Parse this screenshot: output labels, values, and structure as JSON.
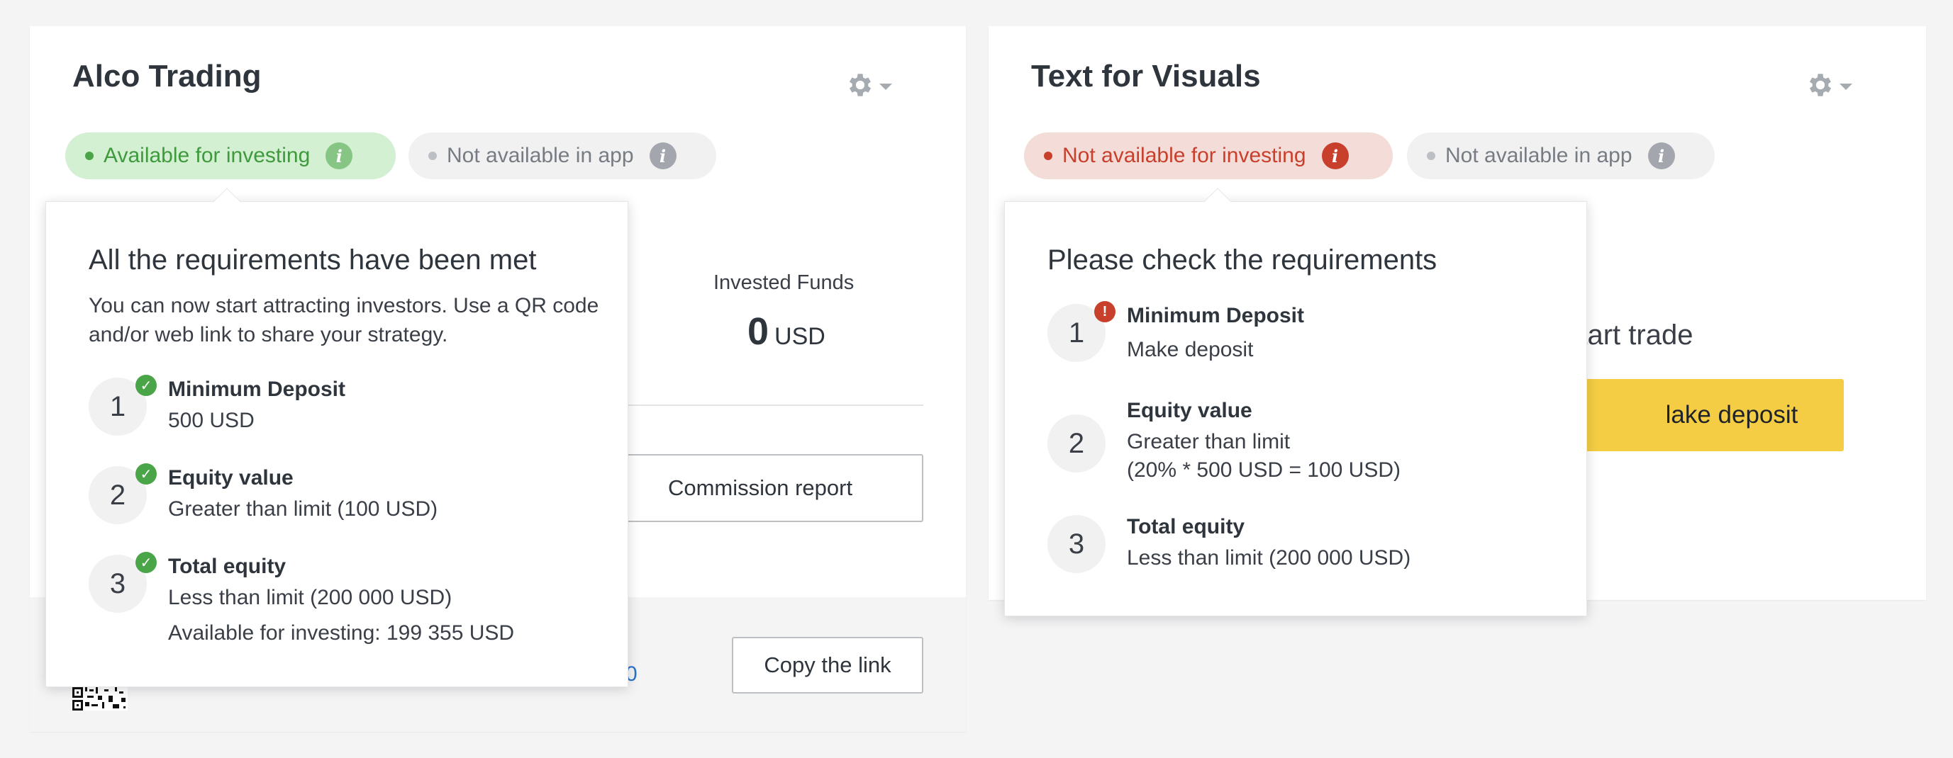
{
  "left_card": {
    "title": "Alco Trading",
    "pill_available": "Available for investing",
    "pill_app": "Not available in app",
    "invested_label": "Invested Funds",
    "invested_value": "0",
    "invested_unit": "USD",
    "commission_button": "Commission report",
    "link_fragment": "0",
    "copy_button": "Copy the link"
  },
  "left_popover": {
    "title": "All the requirements have been met",
    "description": "You can now start attracting investors. Use a QR code and/or web link to share your strategy.",
    "requirements": [
      {
        "num": "1",
        "title": "Minimum Deposit",
        "line1": "500 USD"
      },
      {
        "num": "2",
        "title": "Equity value",
        "line1": "Greater than limit (100 USD)"
      },
      {
        "num": "3",
        "title": "Total equity",
        "line1": "Less than limit (200 000 USD)",
        "line2": "Available for investing: 199 355 USD"
      }
    ]
  },
  "right_card": {
    "title": "Text for Visuals",
    "pill_available": "Not available for investing",
    "pill_app": "Not available in app",
    "start_trade_fragment": "o start trade",
    "deposit_button_fragment": "lake deposit"
  },
  "right_popover": {
    "title": "Please check the requirements",
    "requirements": [
      {
        "num": "1",
        "title": "Minimum Deposit",
        "link": "Make deposit"
      },
      {
        "num": "2",
        "title": "Equity value",
        "line1": "Greater than limit",
        "line2": "(20% * 500 USD = 100 USD)"
      },
      {
        "num": "3",
        "title": "Total equity",
        "line1": "Less than limit (200 000 USD)"
      }
    ]
  },
  "icons": {
    "settings": "gear-icon",
    "dropdown": "caret-down-icon",
    "info": "info-icon",
    "status_ok": "check-circle-icon",
    "status_error": "exclamation-circle-icon"
  },
  "colors": {
    "success": "#49a547",
    "error": "#c8402c",
    "link": "#2f72c4",
    "primary_button": "#f5cd44"
  }
}
